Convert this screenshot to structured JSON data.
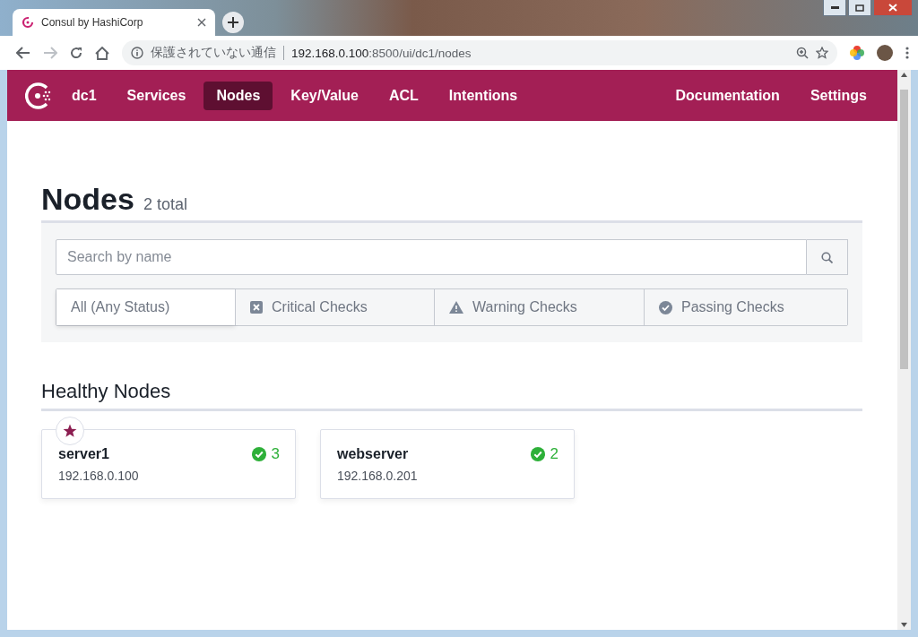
{
  "browser": {
    "tab_title": "Consul by HashiCorp",
    "security_label": "保護されていない通信",
    "url_host": "192.168.0.100",
    "url_rest": ":8500/ui/dc1/nodes"
  },
  "nav": {
    "datacenter": "dc1",
    "items": [
      {
        "label": "Services",
        "selected": false
      },
      {
        "label": "Nodes",
        "selected": true
      },
      {
        "label": "Key/Value",
        "selected": false
      },
      {
        "label": "ACL",
        "selected": false
      },
      {
        "label": "Intentions",
        "selected": false
      }
    ],
    "right_items": [
      "Documentation",
      "Settings"
    ]
  },
  "page": {
    "title": "Nodes",
    "count": "2 total"
  },
  "search": {
    "placeholder": "Search by name"
  },
  "filters": [
    {
      "label": "All (Any Status)",
      "kind": "all",
      "selected": true
    },
    {
      "label": "Critical Checks",
      "kind": "critical",
      "selected": false
    },
    {
      "label": "Warning Checks",
      "kind": "warning",
      "selected": false
    },
    {
      "label": "Passing Checks",
      "kind": "passing",
      "selected": false
    }
  ],
  "section_title": "Healthy Nodes",
  "nodes": [
    {
      "name": "server1",
      "address": "192.168.0.100",
      "checks": "3",
      "leader": true
    },
    {
      "name": "webserver",
      "address": "192.168.0.201",
      "checks": "2",
      "leader": false
    }
  ]
}
